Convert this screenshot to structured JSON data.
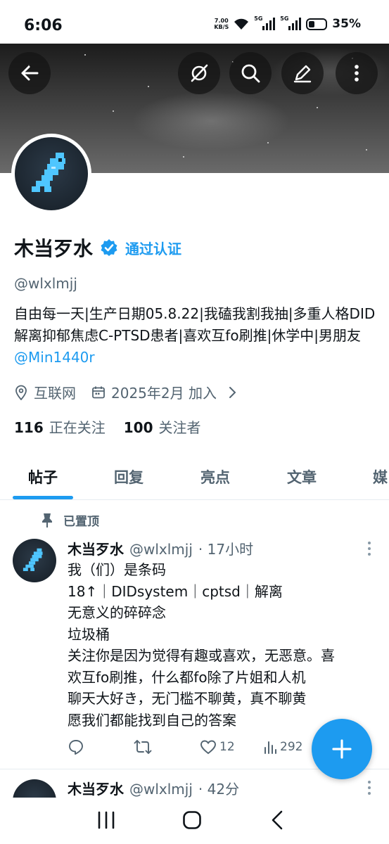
{
  "status_bar": {
    "time": "6:06",
    "net_speed_value": "7.00",
    "net_speed_unit": "KB/S",
    "signal_1_label": "5G",
    "signal_2_label": "5G",
    "battery": "35%"
  },
  "header_actions": {
    "back_icon": "arrow-left-icon",
    "grok_icon": "grok-icon",
    "search_icon": "search-icon",
    "edit_icon": "pencil-icon",
    "more_icon": "more-vertical-icon"
  },
  "profile": {
    "name": "木当歹水",
    "verified_label": "通过认证",
    "handle": "@wlxlmjj",
    "bio_text": "自由每一天|生产日期05.8.22|我磕我割我抽|多重人格DID解离抑郁焦虑C-PTSD患者|喜欢互fo刷推|休学中|男朋友",
    "bio_link": "@Min1440r",
    "location": "互联网",
    "joined": "2025年2月 加入",
    "following_count": "116",
    "following_label": "正在关注",
    "followers_count": "100",
    "followers_label": "关注者"
  },
  "tabs": [
    {
      "label": "帖子"
    },
    {
      "label": "回复"
    },
    {
      "label": "亮点"
    },
    {
      "label": "文章"
    },
    {
      "label": "媒"
    }
  ],
  "pinned_label": "已置顶",
  "posts": [
    {
      "name": "木当歹水",
      "handle": "@wlxlmjj",
      "time": "· 17小时",
      "lines": [
        "我（们）是条码",
        "18↑｜DIDsystem｜cptsd｜解离",
        "无意义的碎碎念",
        "垃圾桶",
        "关注你是因为觉得有趣或喜欢，无恶意。喜",
        "欢互fo刷推，什么都fo除了片姐和人机",
        "聊天大好き，无门槛不聊黄，真不聊黄",
        "愿我们都能找到自己的答案"
      ],
      "likes": "12",
      "views": "292"
    },
    {
      "name": "木当歹水",
      "handle": "@wlxlmjj",
      "time": "· 42分"
    }
  ],
  "colors": {
    "accent": "#1d9bf0",
    "text": "#0f1419",
    "secondary": "#536471"
  }
}
